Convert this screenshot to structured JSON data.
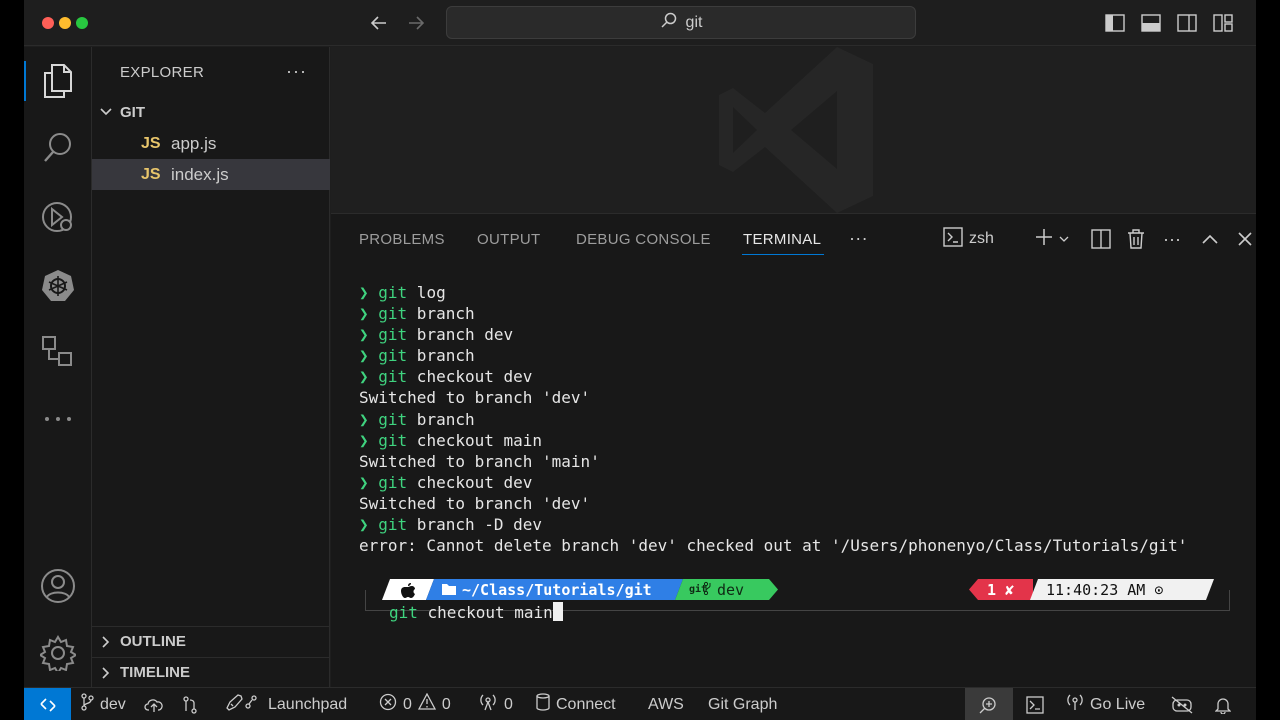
{
  "titlebar": {
    "search_text": "git"
  },
  "sidebar": {
    "explorer_title": "EXPLORER",
    "more": "···",
    "folder": "GIT",
    "files": [
      {
        "badge": "JS",
        "name": "app.js"
      },
      {
        "badge": "JS",
        "name": "index.js"
      }
    ],
    "outline": "OUTLINE",
    "timeline": "TIMELINE"
  },
  "panel": {
    "tabs": [
      "PROBLEMS",
      "OUTPUT",
      "DEBUG CONSOLE",
      "TERMINAL"
    ],
    "active_tab": "TERMINAL",
    "more": "···",
    "shell": "zsh"
  },
  "terminal": {
    "lines": [
      {
        "prompt": "❯ ",
        "git": "git",
        "rest": " log"
      },
      {
        "prompt": "❯ ",
        "git": "git",
        "rest": " branch"
      },
      {
        "prompt": "❯ ",
        "git": "git",
        "rest": " branch dev"
      },
      {
        "prompt": "❯ ",
        "git": "git",
        "rest": " branch"
      },
      {
        "prompt": "❯ ",
        "git": "git",
        "rest": " checkout dev"
      },
      {
        "output": "Switched to branch 'dev'"
      },
      {
        "prompt": "❯ ",
        "git": "git",
        "rest": " branch"
      },
      {
        "prompt": "❯ ",
        "git": "git",
        "rest": " checkout main"
      },
      {
        "output": "Switched to branch 'main'"
      },
      {
        "prompt": "❯ ",
        "git": "git",
        "rest": " checkout dev"
      },
      {
        "output": "Switched to branch 'dev'"
      },
      {
        "prompt": "❯ ",
        "git": "git",
        "rest": " branch -D dev"
      },
      {
        "output": "error: Cannot delete branch 'dev' checked out at '/Users/phonenyo/Class/Tutorials/git'"
      }
    ],
    "prompt_bar": {
      "path_prefix": "~/Class/Tutorials/",
      "path_dir": "git",
      "branch": "dev",
      "error_count": "1 ✘",
      "time": "11:40:23 AM ⊙"
    },
    "current_command_git": "git",
    "current_command_rest": " checkout main"
  },
  "statusbar": {
    "branch": "dev",
    "launchpad": "Launchpad",
    "errors": "0",
    "warnings": "0",
    "ports": "0",
    "connect": "Connect",
    "aws": "AWS",
    "git_graph": "Git Graph",
    "go_live": "Go Live"
  },
  "colors": {
    "accent": "#0078d4",
    "prompt_green": "#3fd37f",
    "path_blue": "#2f7fe6",
    "error_red": "#e3344a"
  }
}
